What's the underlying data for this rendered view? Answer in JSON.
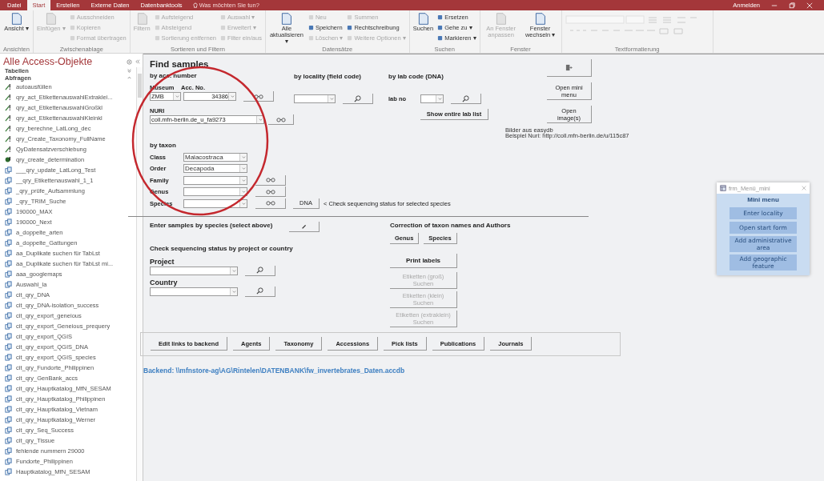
{
  "menu_tabs": [
    {
      "label": "Datei",
      "selected": false
    },
    {
      "label": "Start",
      "selected": true
    },
    {
      "label": "Erstellen",
      "selected": false
    },
    {
      "label": "Externe Daten",
      "selected": false
    },
    {
      "label": "Datenbanktools",
      "selected": false
    }
  ],
  "tell_me": "Was möchten Sie tun?",
  "account": "Anmelden",
  "ribbon": [
    {
      "label": "Ansichten",
      "items": [
        {
          "label": "Ansicht ▾",
          "kind": "large",
          "disabled": false
        }
      ]
    },
    {
      "label": "Zwischenablage",
      "items": [
        {
          "label": "Einfügen ▾",
          "kind": "large",
          "disabled": true
        },
        {
          "label": "Ausschneiden",
          "kind": "small",
          "disabled": true
        },
        {
          "label": "Kopieren",
          "kind": "small",
          "disabled": true
        },
        {
          "label": "Format übertragen",
          "kind": "small",
          "disabled": true
        }
      ]
    },
    {
      "label": "Sortieren und Filtern",
      "items": [
        {
          "label": "Filtern",
          "kind": "large",
          "disabled": true
        },
        {
          "label": "Aufsteigend",
          "kind": "small",
          "disabled": true
        },
        {
          "label": "Absteigend",
          "kind": "small",
          "disabled": true
        },
        {
          "label": "Sortierung entfernen",
          "kind": "small",
          "disabled": true
        },
        {
          "label": "Auswahl ▾",
          "kind": "small",
          "disabled": true
        },
        {
          "label": "Erweitert ▾",
          "kind": "small",
          "disabled": true
        },
        {
          "label": "Filter ein/aus",
          "kind": "small",
          "disabled": true
        }
      ]
    },
    {
      "label": "Datensätze",
      "items": [
        {
          "label": "Alle aktualisieren ▾",
          "kind": "large",
          "disabled": false
        },
        {
          "label": "Neu",
          "kind": "small",
          "disabled": true
        },
        {
          "label": "Speichern",
          "kind": "small",
          "disabled": false
        },
        {
          "label": "Löschen ▾",
          "kind": "small",
          "disabled": true
        },
        {
          "label": "Summen",
          "kind": "small",
          "disabled": true
        },
        {
          "label": "Rechtschreibung",
          "kind": "small",
          "disabled": false
        },
        {
          "label": "Weitere Optionen ▾",
          "kind": "small",
          "disabled": true
        }
      ]
    },
    {
      "label": "Suchen",
      "items": [
        {
          "label": "Suchen",
          "kind": "large",
          "disabled": false
        },
        {
          "label": "Ersetzen",
          "kind": "small",
          "disabled": false
        },
        {
          "label": "Gehe zu ▾",
          "kind": "small",
          "disabled": false
        },
        {
          "label": "Markieren ▾",
          "kind": "small",
          "disabled": false
        }
      ]
    },
    {
      "label": "Fenster",
      "items": [
        {
          "label": "An Fenster anpassen",
          "kind": "large",
          "disabled": true
        },
        {
          "label": "Fenster wechseln ▾",
          "kind": "large",
          "disabled": false
        }
      ]
    },
    {
      "label": "Textformatierung",
      "items": [
        {
          "kind": "formatting",
          "disabled": true
        }
      ]
    }
  ],
  "nav": {
    "title": "Alle Access-Objekte",
    "sections": [
      {
        "label": "Tabellen",
        "expanded": false
      },
      {
        "label": "Abfragen",
        "expanded": true
      }
    ],
    "items": [
      {
        "label": "autoausfüllen",
        "kind": "update"
      },
      {
        "label": "qry_act_EtikettenauswahlExtraklei...",
        "kind": "update"
      },
      {
        "label": "qry_act_EtikettenauswahlGroßkl",
        "kind": "update"
      },
      {
        "label": "qry_act_EtikettenauswahlKleinkl",
        "kind": "update"
      },
      {
        "label": "qry_berechne_LatLong_dec",
        "kind": "update"
      },
      {
        "label": "qry_Create_Taxonomy_FullName",
        "kind": "update"
      },
      {
        "label": "QyDatensatzverschiebung",
        "kind": "update"
      },
      {
        "label": "qry_create_determination",
        "kind": "append"
      },
      {
        "label": "___qry_update_LatLong_Test",
        "kind": "select"
      },
      {
        "label": "__qry_Etikettenauswahl_1_1",
        "kind": "select"
      },
      {
        "label": "_qry_prüfe_Aufsammlung",
        "kind": "select"
      },
      {
        "label": "_qry_TRIM_Suche",
        "kind": "select"
      },
      {
        "label": "190000_MAX",
        "kind": "select"
      },
      {
        "label": "190000_Next",
        "kind": "select"
      },
      {
        "label": "a_doppelte_arten",
        "kind": "select"
      },
      {
        "label": "a_doppelte_Gattungen",
        "kind": "select"
      },
      {
        "label": "aa_Duplikate suchen für TabLst",
        "kind": "select"
      },
      {
        "label": "aa_Duplikate suchen für TabLst mi...",
        "kind": "select"
      },
      {
        "label": "aaa_googlemaps",
        "kind": "select"
      },
      {
        "label": "Auswahl_la",
        "kind": "select"
      },
      {
        "label": "cit_qry_DNA",
        "kind": "select"
      },
      {
        "label": "cit_qry_DNA-isolation_success",
        "kind": "select"
      },
      {
        "label": "cit_qry_export_geneious",
        "kind": "select"
      },
      {
        "label": "cit_qry_export_Geneious_prequery",
        "kind": "select"
      },
      {
        "label": "cit_qry_export_QGIS",
        "kind": "select"
      },
      {
        "label": "cit_qry_export_QGIS_DNA",
        "kind": "select"
      },
      {
        "label": "cit_qry_export_QGIS_species",
        "kind": "select"
      },
      {
        "label": "cit_qry_Fundorte_Philippinen",
        "kind": "select"
      },
      {
        "label": "cit_qry_GenBank_accs",
        "kind": "select"
      },
      {
        "label": "cit_qry_Hauptkatalog_MfN_SESAM",
        "kind": "select"
      },
      {
        "label": "cit_qry_Hauptkatalog_Philippinen",
        "kind": "select"
      },
      {
        "label": "cit_qry_Hauptkatalog_Vietnam",
        "kind": "select"
      },
      {
        "label": "cit_qry_Hauptkatalog_Werner",
        "kind": "select"
      },
      {
        "label": "cit_qry_Seq_Success",
        "kind": "select"
      },
      {
        "label": "cit_qry_Tissue",
        "kind": "select"
      },
      {
        "label": "fehlende nummern 29000",
        "kind": "select"
      },
      {
        "label": "Fundorte_Philippinen",
        "kind": "select"
      },
      {
        "label": "Hauptkatalog_MfN_SESAM",
        "kind": "select"
      }
    ]
  },
  "form": {
    "title": "Find samples",
    "acc": {
      "heading": "by acc. number",
      "museum_label": "Museum",
      "acc_label": "Acc. No.",
      "museum_value": "ZMB",
      "acc_value": "34386"
    },
    "nuri": {
      "label": "NURI",
      "value": "coll.mfn-berlin.de_u_fa9273"
    },
    "locality": {
      "heading": "by locality (field code)"
    },
    "lab": {
      "heading": "by lab code (DNA)",
      "label": "lab no",
      "list_button": "Show entire lab list"
    },
    "side_buttons": [
      {
        "kind": "exit"
      },
      {
        "kind": "text",
        "label": "Open mini menu"
      },
      {
        "kind": "text",
        "label": "Open image(s)"
      }
    ],
    "image_note": [
      "Bilder aus easydb",
      "Beispiel Nuri: http://coll.mfn-berlin.de/u/115c87"
    ],
    "taxon": {
      "heading": "by taxon",
      "rows": [
        {
          "label": "Class",
          "value": "Malacostraca",
          "button": false
        },
        {
          "label": "Order",
          "value": "Decapoda",
          "button": false
        },
        {
          "label": "Family",
          "button": true
        },
        {
          "label": "Genus",
          "button": true
        },
        {
          "label": "Species",
          "button": true
        }
      ],
      "dna_button": "DNA",
      "note": "< Check sequencing status for selected species"
    },
    "enter": "Enter samples by species (select above)",
    "check": {
      "heading": "Check sequencing status by project or country",
      "fields": [
        {
          "label": "Project"
        },
        {
          "label": "Country"
        }
      ]
    },
    "correction": {
      "heading": "Correction of taxon names and Authors",
      "buttons": [
        "Genus",
        "Species"
      ]
    },
    "labels": [
      {
        "label": "Print labels",
        "disabled": false
      },
      {
        "label": "Etiketten (groß) Suchen",
        "disabled": true
      },
      {
        "label": "Etiketten (klein) Suchen",
        "disabled": true
      },
      {
        "label": "Etiketten (extraklein) Suchen",
        "disabled": true
      }
    ],
    "bottom_buttons": [
      "Edit links to backend",
      "Agents",
      "Taxonomy",
      "Accessions",
      "Pick lists",
      "Publications",
      "Journals"
    ],
    "backend": "Backend: \\\\mfnstore-ag\\AG\\Rintelen\\DATENBANK\\fw_invertebrates_Daten.accdb"
  },
  "mini_menu": {
    "title": "frm_Menü_mini",
    "heading": "Mini menu",
    "buttons": [
      "Enter locality",
      "Open start form",
      "Add administrative area",
      "Add geographic feature"
    ]
  }
}
